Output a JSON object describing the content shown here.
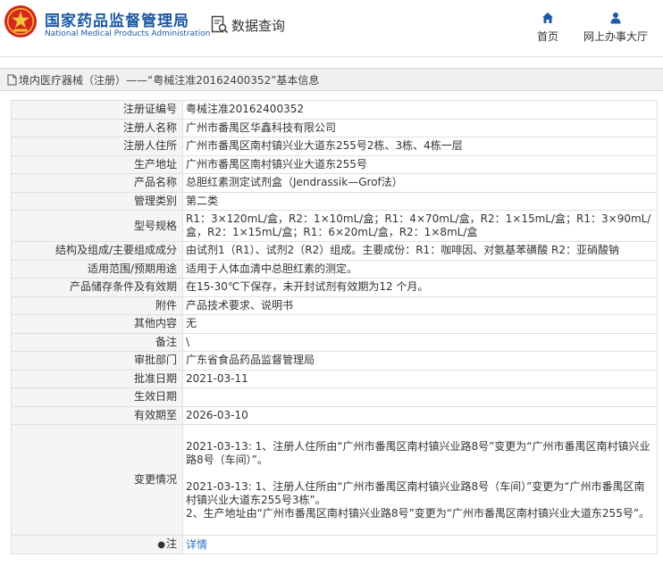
{
  "header": {
    "brand_cn": "国家药品监督管理局",
    "brand_en": "National Medical Products Administration",
    "query_label": "数据查询",
    "nav": {
      "home": "首页",
      "office": "网上办事大厅"
    }
  },
  "title": "境内医疗器械（注册）——“粤械注准20162400352”基本信息",
  "rows": [
    {
      "label": "注册证编号",
      "value": "粤械注准20162400352"
    },
    {
      "label": "注册人名称",
      "value": "广州市番禺区华鑫科技有限公司"
    },
    {
      "label": "注册人住所",
      "value": "广州市番禺区南村镇兴业大道东255号2栋、3栋、4栋一层"
    },
    {
      "label": "生产地址",
      "value": "广州市番禺区南村镇兴业大道东255号"
    },
    {
      "label": "产品名称",
      "value": "总胆红素测定试剂盒（Jendrassik—Grof法）"
    },
    {
      "label": "管理类别",
      "value": "第二类"
    },
    {
      "label": "型号规格",
      "value": "R1：3×120mL/盒，R2：1×10mL/盒；R1：4×70mL/盒，R2：1×15mL/盒；R1：3×90mL/盒，R2：1×15mL/盒；R1：6×20mL/盒，R2：1×8mL/盒"
    },
    {
      "label": "结构及组成/主要组成成分",
      "value": "由试剂1（R1）、试剂2（R2）组成。主要成份：R1：咖啡因、对氨基苯磺酸 R2：亚硝酸钠"
    },
    {
      "label": "适用范围/预期用途",
      "value": "适用于人体血清中总胆红素的测定。"
    },
    {
      "label": "产品储存条件及有效期",
      "value": "在15-30℃下保存，未开封试剂有效期为12 个月。"
    },
    {
      "label": "附件",
      "value": "产品技术要求、说明书"
    },
    {
      "label": "其他内容",
      "value": "无"
    },
    {
      "label": "备注",
      "value": "\\"
    },
    {
      "label": "审批部门",
      "value": "广东省食品药品监督管理局"
    },
    {
      "label": "批准日期",
      "value": "2021-03-11"
    },
    {
      "label": "生效日期",
      "value": ""
    },
    {
      "label": "有效期至",
      "value": "2026-03-10"
    }
  ],
  "changes": {
    "label": "变更情况",
    "entry1": "2021-03-13: 1、注册人住所由“广州市番禺区南村镇兴业路8号”变更为“广州市番禺区南村镇兴业路8号（车间）”。",
    "entry2": "2021-03-13: 1、注册人住所由“广州市番禺区南村镇兴业路8号（车间）”变更为“广州市番禺区南村镇兴业大道东255号3栋”。\n2、生产地址由“广州市番禺区南村镇兴业路8号”变更为“广州市番禺区南村镇兴业大道东255号”。"
  },
  "note": {
    "label": "注",
    "value": "详情"
  },
  "colors": {
    "brand": "#1c5aa6",
    "logo_red": "#d7261e",
    "link": "#2a6fc4"
  },
  "icons": {
    "logo": "emblem-logo",
    "query": "search-document-icon",
    "home": "home-icon",
    "office": "user-icon",
    "title": "document-icon",
    "note": "pin-icon"
  }
}
